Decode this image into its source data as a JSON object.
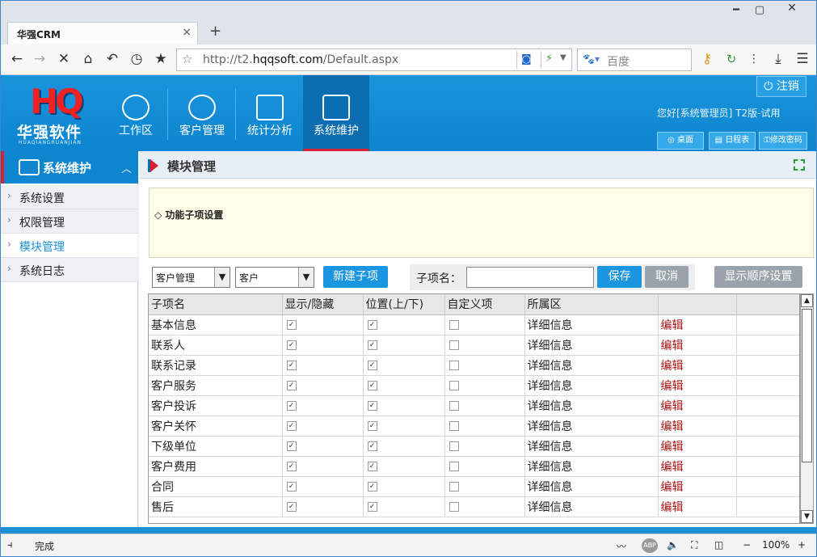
{
  "browser": {
    "tab_title": "华强CRM",
    "tab_close": "×",
    "new_tab": "+",
    "url_prefix": "http://t2.",
    "url_domain": "hqqsoft.com",
    "url_path": "/Default.aspx",
    "search_placeholder": "百度",
    "min_label": "━",
    "max_label": "▢",
    "close_label": "✕",
    "zoom": "100%",
    "status_text": "完成"
  },
  "app": {
    "brand_mark": "HQ",
    "brand_cn": "华强软件",
    "brand_pinyin": "HUAQIANGRUANJIAN",
    "modules": [
      {
        "label": "工作区"
      },
      {
        "label": "客户管理"
      },
      {
        "label": "统计分析"
      },
      {
        "label": "系统维护"
      }
    ],
    "logout_label": "注销",
    "greeting": "您好[系统管理员] T2版-试用",
    "header_buttons": [
      "桌面",
      "日程表",
      "修改密码"
    ]
  },
  "sidebar": {
    "title": "系统维护",
    "items": [
      {
        "label": "系统设置"
      },
      {
        "label": "权限管理"
      },
      {
        "label": "模块管理"
      },
      {
        "label": "系统日志"
      }
    ]
  },
  "main": {
    "title": "模块管理",
    "section_title": "◇ 功能子项设置",
    "select1": "客户管理",
    "select2": "客户",
    "new_button": "新建子项",
    "subitem_label": "子项名：",
    "save_button": "保存",
    "cancel_button": "取消",
    "order_button": "显示顺序设置",
    "columns": [
      "子项名",
      "显示/隐藏",
      "位置(上/下)",
      "自定义项",
      "所属区",
      "",
      ""
    ],
    "rows": [
      {
        "name": "基本信息",
        "area": "详细信息",
        "edit": "编辑"
      },
      {
        "name": "联系人",
        "area": "详细信息",
        "edit": "编辑"
      },
      {
        "name": "联系记录",
        "area": "详细信息",
        "edit": "编辑"
      },
      {
        "name": "客户服务",
        "area": "详细信息",
        "edit": "编辑"
      },
      {
        "name": "客户投诉",
        "area": "详细信息",
        "edit": "编辑"
      },
      {
        "name": "客户关怀",
        "area": "详细信息",
        "edit": "编辑"
      },
      {
        "name": "下级单位",
        "area": "详细信息",
        "edit": "编辑"
      },
      {
        "name": "客户费用",
        "area": "详细信息",
        "edit": "编辑"
      },
      {
        "name": "合同",
        "area": "详细信息",
        "edit": "编辑"
      },
      {
        "name": "售后",
        "area": "详细信息",
        "edit": "编辑"
      }
    ]
  }
}
